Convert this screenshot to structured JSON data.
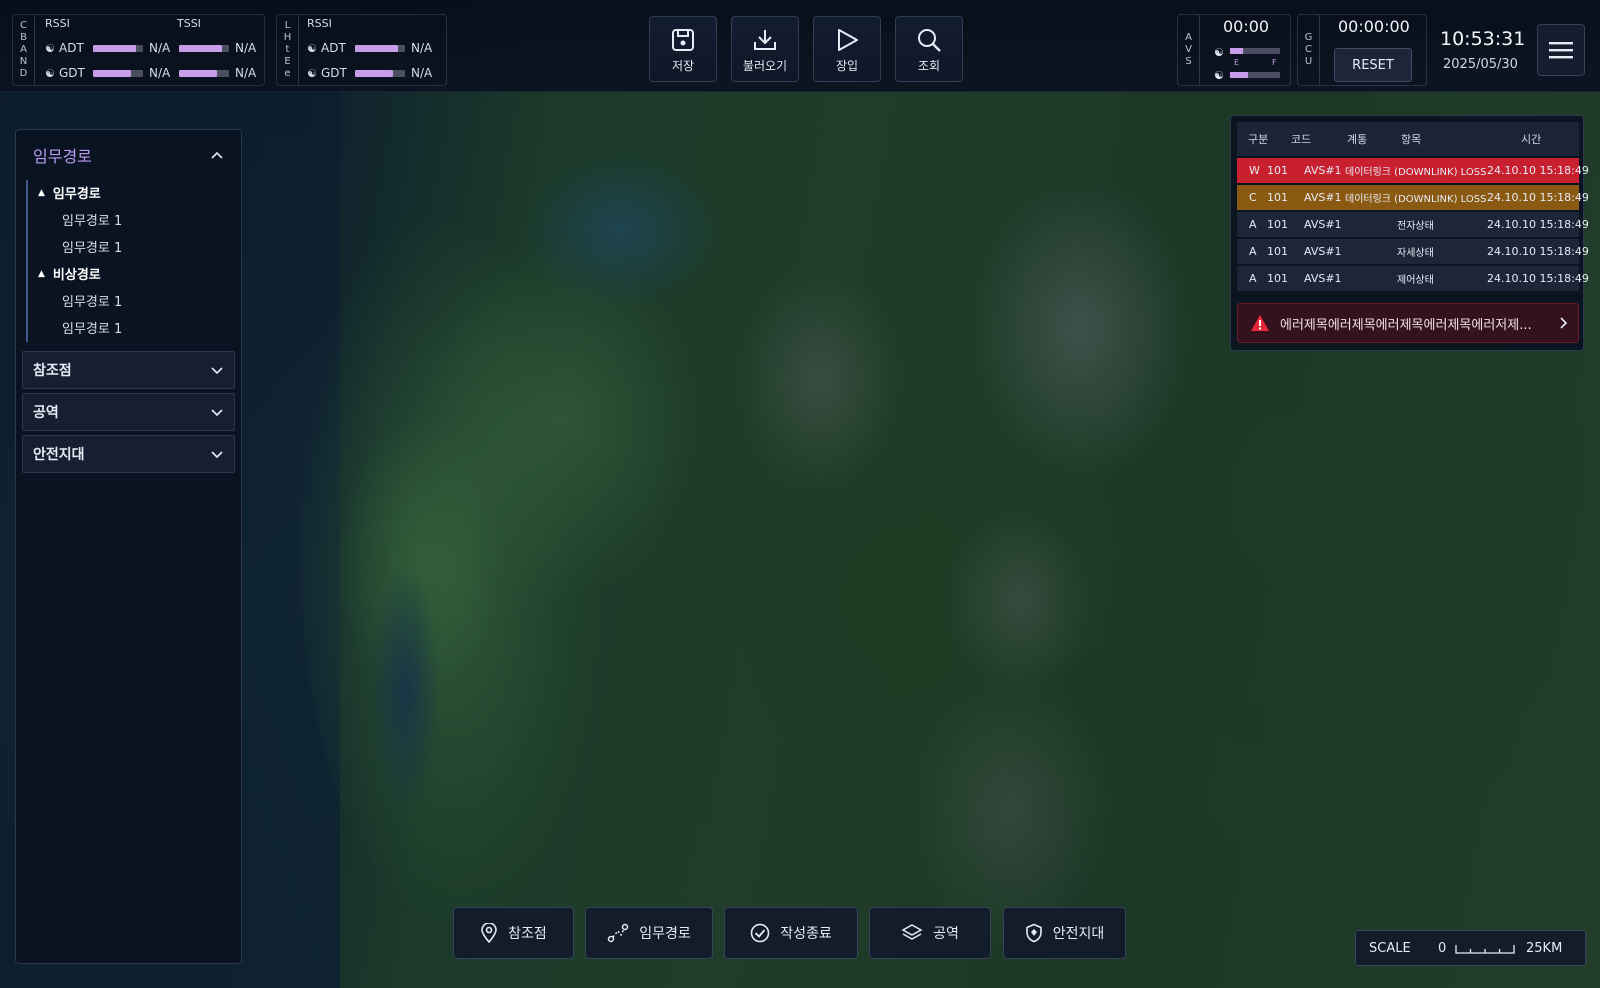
{
  "topbar": {
    "cband": {
      "label_letters": [
        "C",
        "B",
        "A",
        "N",
        "D"
      ],
      "rssi_label": "RSSI",
      "tssi_label": "TSSI",
      "adt_label": "ADT",
      "gdt_label": "GDT",
      "adt_rssi": "N/A",
      "adt_tssi": "N/A",
      "gdt_rssi": "N/A",
      "gdt_tssi": "N/A",
      "adt_rssi_level": 0.85,
      "adt_tssi_level": 0.85,
      "gdt_rssi_level": 0.75,
      "gdt_tssi_level": 0.75
    },
    "lhtee": {
      "label_letters": [
        "L",
        "H",
        "t",
        "E",
        "e"
      ],
      "rssi_label": "RSSI",
      "adt_label": "ADT",
      "gdt_label": "GDT",
      "adt_rssi": "N/A",
      "gdt_rssi": "N/A",
      "adt_rssi_level": 0.85,
      "gdt_rssi_level": 0.75
    },
    "tools": [
      {
        "label": "저장",
        "icon": "save-icon"
      },
      {
        "label": "불러오기",
        "icon": "download-icon"
      },
      {
        "label": "장입",
        "icon": "play-icon"
      },
      {
        "label": "조회",
        "icon": "search-icon"
      }
    ],
    "avs": {
      "label_letters": [
        "A",
        "V",
        "S"
      ],
      "time": "00:00",
      "gauge_top_level": 0.25,
      "gauge_bottom_level": 0.35,
      "gauge_letters": [
        "E",
        "F"
      ]
    },
    "gcu": {
      "label_letters": [
        "G",
        "C",
        "U"
      ],
      "time": "00:00:00",
      "reset_label": "RESET"
    },
    "clock": "10:53:31",
    "date": "2025/05/30"
  },
  "sidebar": {
    "sections": [
      {
        "title": "임무경로",
        "expanded": true
      },
      {
        "title": "참조점",
        "expanded": false
      },
      {
        "title": "공역",
        "expanded": false
      },
      {
        "title": "안전지대",
        "expanded": false
      }
    ],
    "tree": {
      "group1": "임무경로",
      "group1_items": [
        "임무경로 1",
        "임무경로 1"
      ],
      "group2": "비상경로",
      "group2_items": [
        "임무경로 1",
        "임무경로 1"
      ]
    }
  },
  "alarm": {
    "headers": [
      "구분",
      "코드",
      "계통",
      "항목",
      "시간"
    ],
    "rows": [
      {
        "level": "W",
        "code": "101",
        "system": "AVS#1",
        "item": "데이터링크 (DOWNLINK) LOSS",
        "time": "24.10.10 15:18:49",
        "color": "#c8202e"
      },
      {
        "level": "C",
        "code": "101",
        "system": "AVS#1",
        "item": "데이터링크 (DOWNLINK) LOSS",
        "time": "24.10.10 15:18:49",
        "color": "#8a5a12"
      },
      {
        "level": "A",
        "code": "101",
        "system": "AVS#1",
        "item": "전자상태",
        "time": "24.10.10 15:18:49",
        "color": "#1c2638"
      },
      {
        "level": "A",
        "code": "101",
        "system": "AVS#1",
        "item": "자세상태",
        "time": "24.10.10 15:18:49",
        "color": "#1c2638"
      },
      {
        "level": "A",
        "code": "101",
        "system": "AVS#1",
        "item": "제어상태",
        "time": "24.10.10 15:18:49",
        "color": "#1c2638"
      }
    ],
    "message": "에러제목에러제목에러제목에러제목에러저제..."
  },
  "bottom_tools": [
    {
      "label": "참조점",
      "icon": "location-pin-icon"
    },
    {
      "label": "임무경로",
      "icon": "route-icon"
    },
    {
      "label": "작성종료",
      "icon": "check-circle-icon"
    },
    {
      "label": "공역",
      "icon": "layers-icon"
    },
    {
      "label": "안전지대",
      "icon": "shield-icon"
    }
  ],
  "scale": {
    "label": "SCALE",
    "min": "0",
    "max": "25KM"
  },
  "colors": {
    "accent_purple": "#b99cf0",
    "signal_bar": "#c79ce8",
    "warning_red": "#c8202e",
    "caution_amber": "#8a5a12"
  }
}
